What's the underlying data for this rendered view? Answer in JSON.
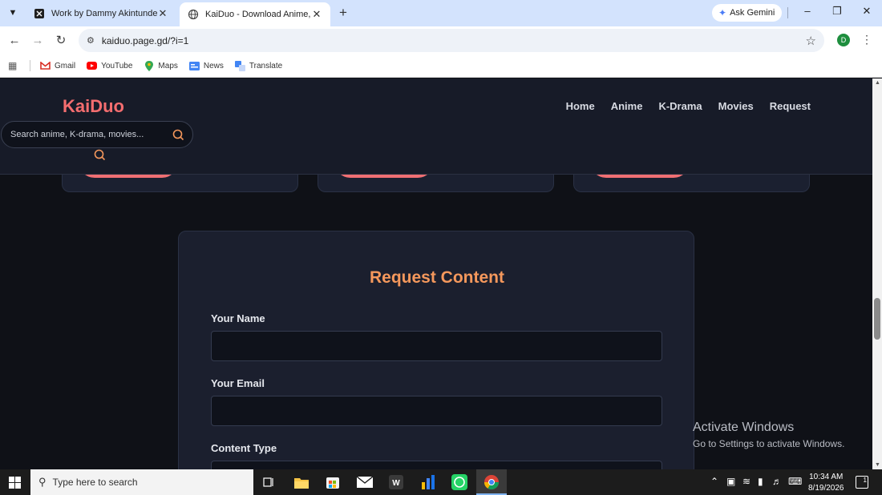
{
  "browser": {
    "tabs": [
      {
        "title": "Work by Dammy Akintunde",
        "active": false
      },
      {
        "title": "KaiDuo - Download Anime, K-D",
        "active": true
      }
    ],
    "new_tab_label": "+",
    "gemini_label": "Ask Gemini",
    "url": "kaiduo.page.gd/?i=1",
    "profile_initial": "D",
    "bookmarks": [
      "Gmail",
      "YouTube",
      "Maps",
      "News",
      "Translate"
    ]
  },
  "site": {
    "logo": "KaiDuo",
    "nav": [
      "Home",
      "Anime",
      "K-Drama",
      "Movies",
      "Request"
    ],
    "search_placeholder": "Search anime, K-drama, movies..."
  },
  "request_form": {
    "title": "Request Content",
    "fields": [
      {
        "label": "Your Name",
        "value": ""
      },
      {
        "label": "Your Email",
        "value": ""
      },
      {
        "label": "Content Type",
        "value": ""
      }
    ]
  },
  "watermark": {
    "line1": "Activate Windows",
    "line2": "Go to Settings to activate Windows."
  },
  "taskbar": {
    "search_placeholder": "Type here to search",
    "time": "10:34 AM",
    "date": "8/19/2026",
    "notification_count": "1"
  },
  "colors": {
    "accent": "#f46d6f",
    "title": "#f5985c",
    "page_bg": "#0f1117",
    "panel_bg": "#1b1f2e"
  }
}
